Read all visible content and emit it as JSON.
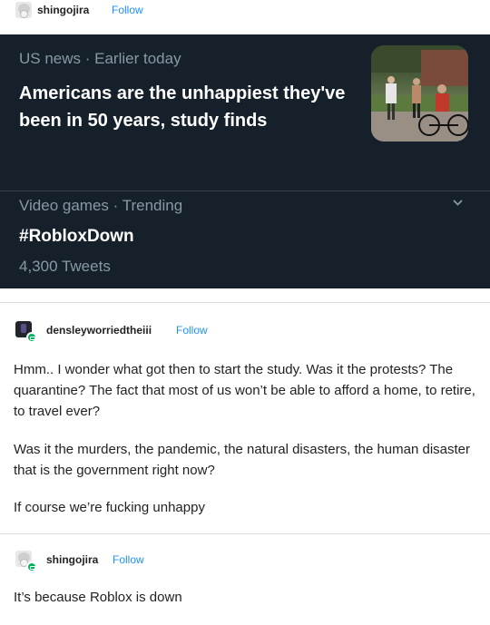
{
  "post1": {
    "username": "shingojira",
    "follow": "Follow"
  },
  "tweet": {
    "item1": {
      "category": "US news · Earlier today",
      "headline": "Americans are the unhappiest they've been in 50 years, study finds"
    },
    "item2": {
      "category": "Video games · Trending",
      "hashtag": "#RobloxDown",
      "count": "4,300 Tweets"
    }
  },
  "post2": {
    "username": "densleyworriedtheiii",
    "follow": "Follow",
    "paragraphs": [
      "Hmm.. I wonder what got then to start the study. Was it the protests? The quarantine? The fact that most of us won’t be able to afford a home, to retire, to travel ever?",
      "Was it the murders, the pandemic, the natural disasters, the human disaster that is the government right now?",
      "If course we’re fucking unhappy"
    ]
  },
  "post3": {
    "username": "shingojira",
    "follow": "Follow",
    "text": "It’s because Roblox is down"
  },
  "colors": {
    "tweet_bg": "#15202b",
    "muted": "#8899a6",
    "link": "#1e90ff",
    "badge": "#00b35a"
  }
}
